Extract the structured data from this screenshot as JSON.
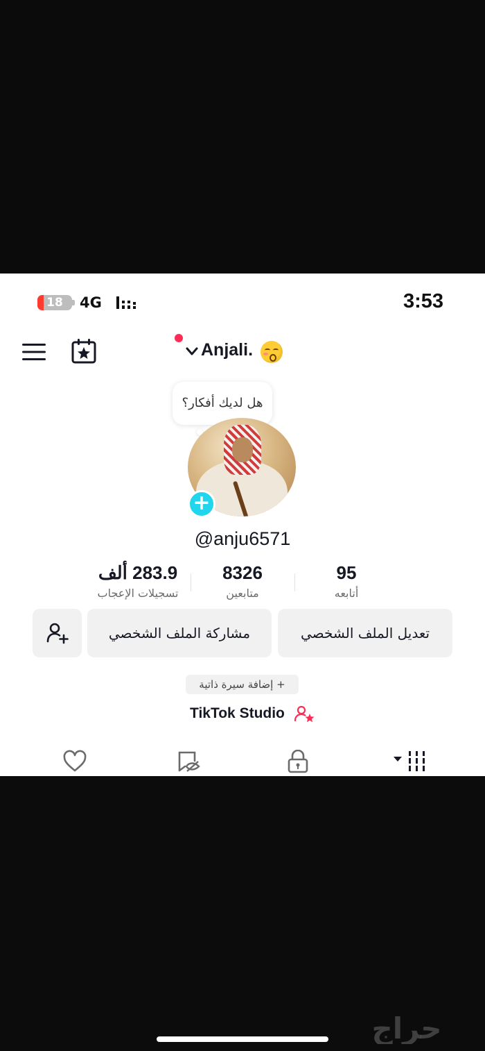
{
  "status_bar": {
    "battery_level": "18",
    "network": "4G",
    "time": "3:53"
  },
  "header": {
    "username": "Anjali.",
    "emoji_icon": "kissing-face-emoji",
    "menu_icon": "hamburger-menu-icon",
    "calendar_icon": "calendar-star-icon"
  },
  "bubble": {
    "text": "هل لديك أفكار؟"
  },
  "profile": {
    "handle": "@anju6571"
  },
  "stats": {
    "likes_value": "283.9 ألف",
    "likes_label": "تسجيلات الإعجاب",
    "followers_value": "8326",
    "followers_label": "متابعين",
    "following_value": "95",
    "following_label": "أتابعه"
  },
  "buttons": {
    "edit_profile": "تعديل الملف الشخصي",
    "share_profile": "مشاركة الملف الشخصي"
  },
  "bio": {
    "add_bio": "+ إضافة سيرة ذاتية"
  },
  "studio": {
    "label": "TikTok Studio"
  },
  "colors": {
    "accent_red": "#fe2c55",
    "add_cyan": "#20d5ec",
    "button_bg": "#f1f1f2"
  },
  "watermark": {
    "text": "حراج"
  }
}
